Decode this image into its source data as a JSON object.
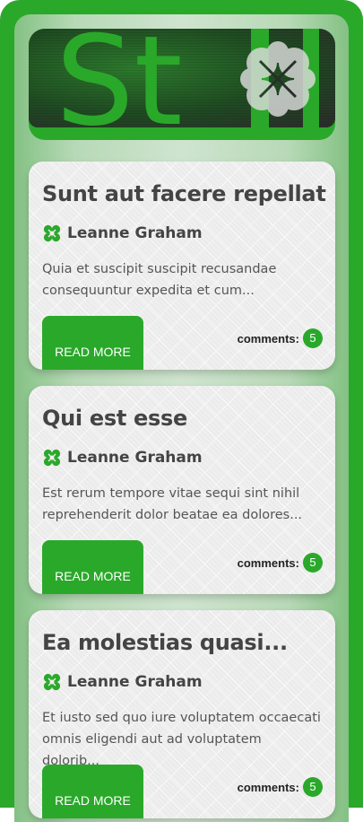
{
  "header": {
    "banner_letters": "St"
  },
  "posts": [
    {
      "title": "Sunt aut facere repellat...",
      "author": "Leanne Graham",
      "excerpt": "Quia et suscipit suscipit recusandae consequuntur expedita et cum...",
      "read_more_label": "READ MORE",
      "comments_label": "comments:",
      "comments_count": "5"
    },
    {
      "title": "Qui est esse",
      "author": "Leanne Graham",
      "excerpt": "Est rerum tempore vitae sequi sint nihil reprehenderit dolor beatae ea dolores...",
      "read_more_label": "READ MORE",
      "comments_label": "comments:",
      "comments_count": "5"
    },
    {
      "title": "Ea molestias quasi...",
      "author": "Leanne Graham",
      "excerpt": "Et iusto sed quo iure voluptatem occaecati omnis eligendi aut ad voluptatem dolorib...",
      "read_more_label": "READ MORE",
      "comments_label": "comments:",
      "comments_count": "5"
    }
  ],
  "icons": {
    "author_icon": "clover-icon",
    "banner_icon": "clover-icon"
  },
  "colors": {
    "accent": "#2aa82a",
    "text": "#444444"
  }
}
